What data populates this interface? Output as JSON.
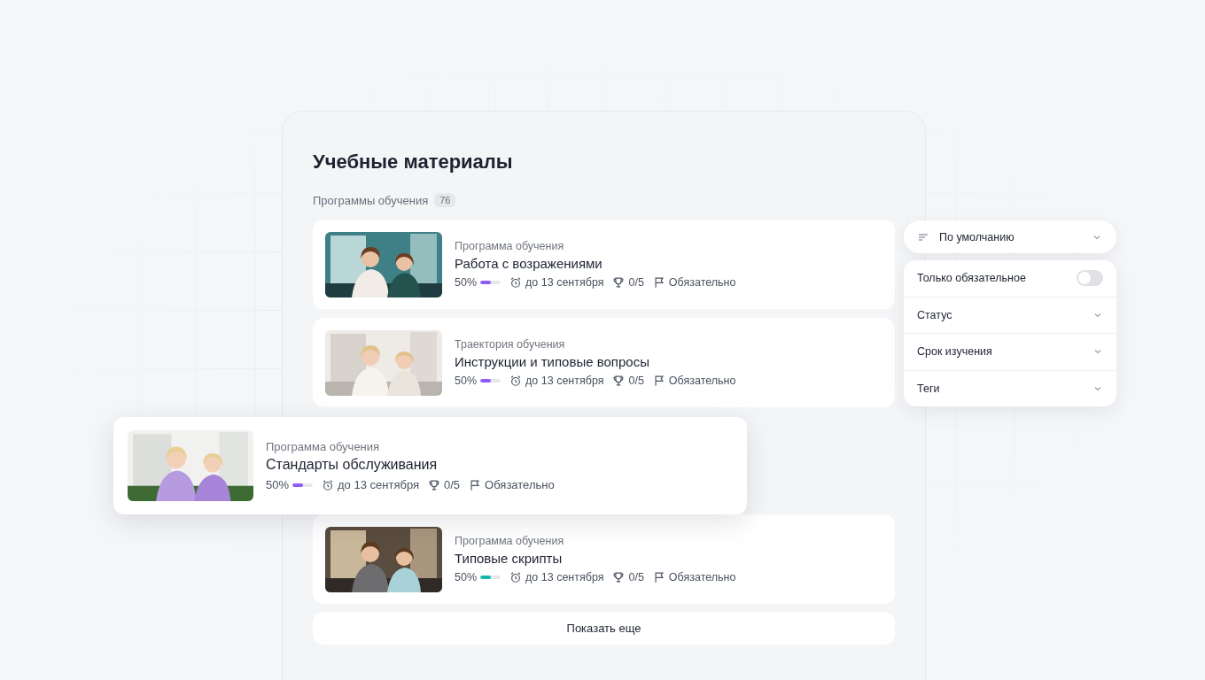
{
  "page": {
    "title": "Учебные материалы"
  },
  "section": {
    "label": "Программы обучения",
    "count": "76"
  },
  "courses": [
    {
      "type": "Программа обучения",
      "title": "Работа с возражениями",
      "progress": "50%",
      "level": 0.5,
      "color": "#8b5cf6",
      "deadline": "до 13 сентября",
      "score": "0/5",
      "required": "Обязательно",
      "floating": false
    },
    {
      "type": "Траектория обучения",
      "title": "Инструкции и типовые вопросы",
      "progress": "50%",
      "level": 0.5,
      "color": "#8b5cf6",
      "deadline": "до 13 сентября",
      "score": "0/5",
      "required": "Обязательно",
      "floating": false
    },
    {
      "type": "Программа обучения",
      "title": "Стандарты обслуживания",
      "progress": "50%",
      "level": 0.5,
      "color": "#8b5cf6",
      "deadline": "до 13 сентября",
      "score": "0/5",
      "required": "Обязательно",
      "floating": true
    },
    {
      "type": "Программа обучения",
      "title": "Типовые скрипты",
      "progress": "50%",
      "level": 0.5,
      "color": "#14b8a6",
      "deadline": "до 13 сентября",
      "score": "0/5",
      "required": "Обязательно",
      "floating": false
    }
  ],
  "more_button": "Показать еще",
  "sort": {
    "value": "По умолчанию"
  },
  "filters": [
    {
      "kind": "toggle",
      "label": "Только обязательное",
      "on": false
    },
    {
      "kind": "dropdown",
      "label": "Статус"
    },
    {
      "kind": "dropdown",
      "label": "Срок изучения"
    },
    {
      "kind": "dropdown",
      "label": "Теги"
    }
  ]
}
